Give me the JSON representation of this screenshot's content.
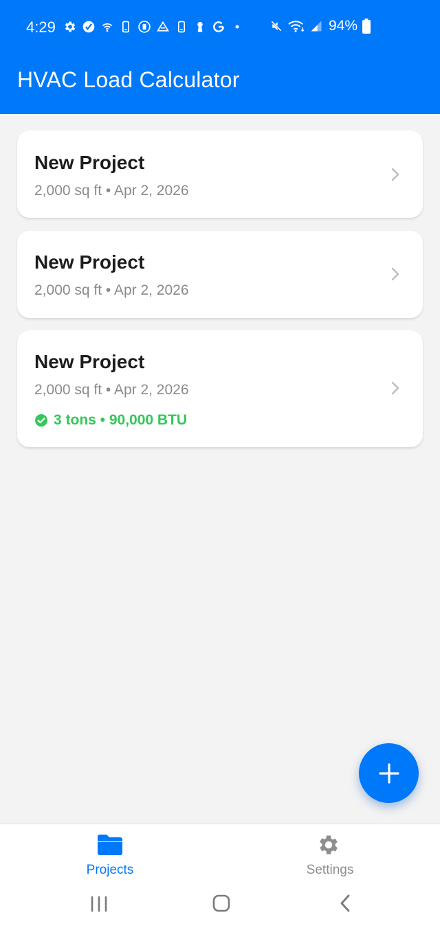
{
  "status_bar": {
    "time": "4:29",
    "battery": "94%",
    "icons_left": [
      "gear-icon",
      "vpn-check-icon",
      "wifi-call-icon",
      "phone-icon",
      "battery-saver-icon",
      "drive-icon",
      "phone-icon",
      "keyhole-icon",
      "google-icon",
      "dot-icon"
    ],
    "icons_right": [
      "mute-icon",
      "wifi-icon",
      "signal-icon",
      "battery-icon"
    ]
  },
  "header": {
    "title": "HVAC Load Calculator"
  },
  "colors": {
    "primary": "#0078fa",
    "success": "#34c759",
    "background": "#f3f3f3",
    "muted": "#8a8a8a"
  },
  "projects": [
    {
      "name": "New Project",
      "meta": "2,000 sq ft • Apr 2, 2026"
    },
    {
      "name": "New Project",
      "meta": "2,000 sq ft • Apr 2, 2026"
    },
    {
      "name": "New Project",
      "meta": "2,000 sq ft • Apr 2, 2026",
      "result": "3 tons • 90,000 BTU"
    }
  ],
  "fab": {
    "icon": "plus-icon"
  },
  "tabs": [
    {
      "label": "Projects",
      "icon": "folder-icon",
      "active": true
    },
    {
      "label": "Settings",
      "icon": "gear-icon",
      "active": false
    }
  ],
  "system_nav": {
    "buttons": [
      "recent-apps-icon",
      "home-icon",
      "back-icon"
    ]
  }
}
